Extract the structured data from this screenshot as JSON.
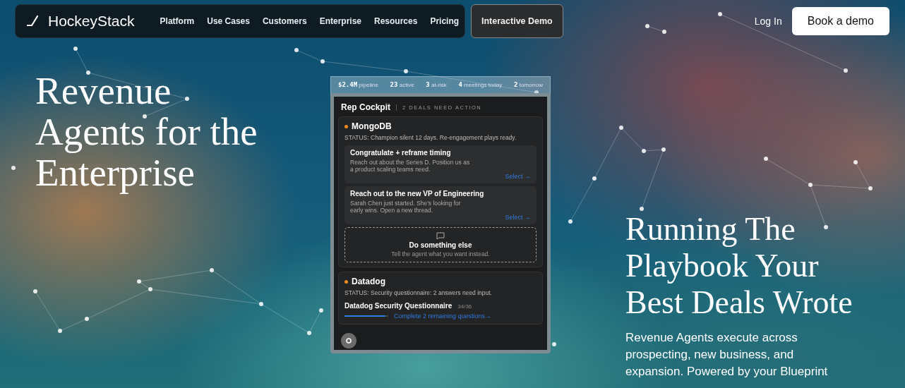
{
  "nav": {
    "logo": "HockeyStack",
    "links": [
      {
        "label": "Platform"
      },
      {
        "label": "Use Cases"
      },
      {
        "label": "Customers"
      },
      {
        "label": "Enterprise"
      },
      {
        "label": "Resources"
      },
      {
        "label": "Pricing"
      }
    ],
    "demo_button": "Interactive Demo",
    "login": "Log In",
    "cta": "Book a demo"
  },
  "hero": {
    "title": "Revenue Agents for the Enterprise"
  },
  "cockpit": {
    "stats": [
      {
        "value": "$2.4M",
        "label": "pipeline"
      },
      {
        "value": "23",
        "label": "active"
      },
      {
        "value": "3",
        "label": "at-risk"
      },
      {
        "value": "4",
        "label": "meetings today"
      },
      {
        "value": "2",
        "label": "tomorrow"
      }
    ],
    "title": "Rep Cockpit",
    "subtitle": "2 DEALS NEED ACTION",
    "deals": [
      {
        "name": "MongoDB",
        "color": "#f08a1c",
        "status": "STATUS: Champion silent 12 days. Re-engagement plays ready.",
        "kind": "plays",
        "plays": [
          {
            "title": "Congratulate + reframe timing",
            "text": "Reach out about the Series D. Position us as a product scaling teams need.",
            "action": "Select →"
          },
          {
            "title": "Reach out to the new VP of Engineering",
            "text": "Sarah Chen just started. She's looking for early wins. Open a new thread.",
            "action": "Select →"
          }
        ],
        "other": {
          "title": "Do something else",
          "text": "Tell the agent what you want instead."
        }
      },
      {
        "name": "Datadog",
        "color": "#f08a1c",
        "status": "STATUS: Security questionnaire: 2 answers need input.",
        "kind": "task",
        "task": {
          "title": "Datadog Security Questionnaire",
          "count": "34/36",
          "level": 0.94,
          "action": "Complete 2 remaining questions→"
        }
      }
    ]
  },
  "feature": {
    "title": "Running The Playbook Your Best Deals Wrote",
    "text": "Revenue Agents execute across prospecting, new business, and expansion. Powered by your Blueprint"
  }
}
